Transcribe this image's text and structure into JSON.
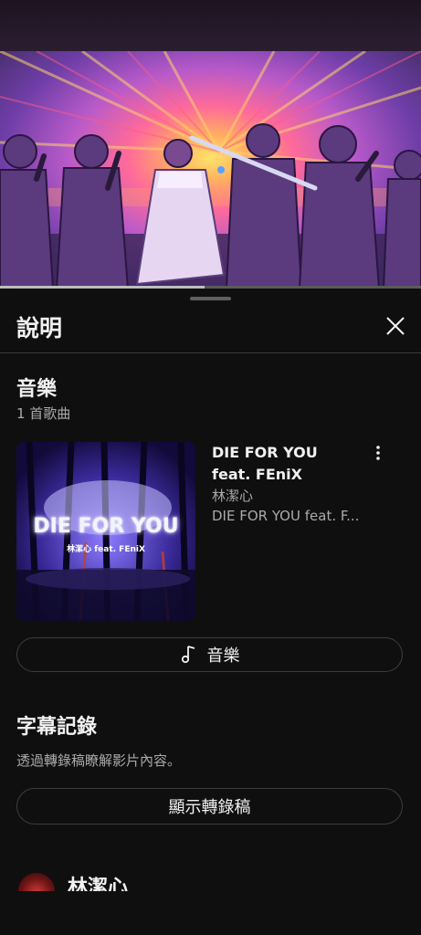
{
  "sheet": {
    "title": "說明"
  },
  "music_section": {
    "title": "音樂",
    "count_label": "1 首歌曲",
    "song": {
      "title": "DIE FOR YOU feat. FEniX",
      "artist": "林潔心",
      "album": "DIE FOR YOU feat. F...",
      "art_title": "DIE FOR YOU",
      "art_subtitle": "林潔心 feat. FEniX"
    },
    "button_label": "音樂"
  },
  "transcript_section": {
    "title": "字幕記錄",
    "description": "透過轉錄稿瞭解影片內容。",
    "button_label": "顯示轉錄稿"
  },
  "channel": {
    "name": "林潔心"
  },
  "icons": {
    "close": "close-icon",
    "more": "more-vert-icon",
    "music_note": "music-note-icon"
  },
  "colors": {
    "background": "#0f0f0f",
    "text_primary": "#f1f1f1",
    "text_secondary": "#aaaaaa",
    "border": "#3d3d3d"
  }
}
